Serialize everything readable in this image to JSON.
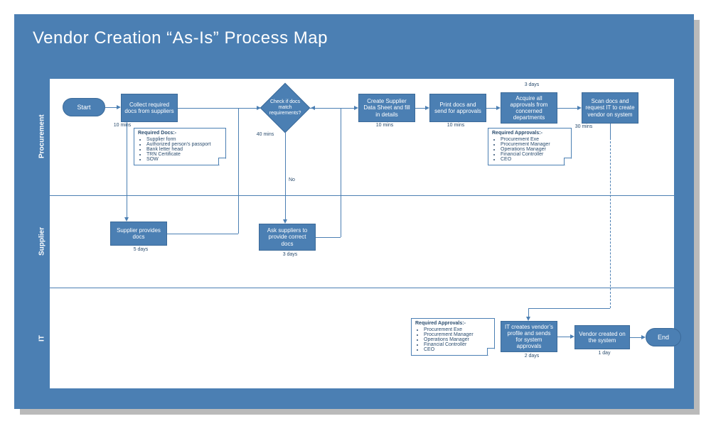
{
  "title": "Vendor Creation “As-Is” Process Map",
  "lanes": {
    "procurement": "Procurement",
    "supplier": "Supplier",
    "it": "IT"
  },
  "shapes": {
    "start": "Start",
    "collect": "Collect required docs from suppliers",
    "check": "Check if docs match requirements?",
    "create_sheet": "Create Supplier Data Sheet and fill in details",
    "print_send": "Print docs and send for approvals",
    "acquire": "Acquire all approvals from concerned departments",
    "scan_request": "Scan docs and request IT to create vendor on system",
    "supplier_provides": "Supplier provides docs",
    "ask_correct": "Ask suppliers to provide correct docs",
    "it_creates": "IT creates vendor’s profile and sends for system approvals",
    "vendor_created": "Vendor created on the system",
    "end": "End"
  },
  "timings": {
    "collect": "10 mins",
    "check": "40 mins",
    "create_sheet": "10 mins",
    "print_send": "10 mins",
    "acquire_top": "3 days",
    "scan_request": "30 mins",
    "supplier_provides": "5 days",
    "ask_correct": "3 days",
    "it_creates": "2 days",
    "vendor_created": "1 day"
  },
  "labels": {
    "no": "No"
  },
  "notes": {
    "required_docs": {
      "title": "Required Docs:-",
      "items": [
        "Supplier form",
        "Authorized person's passport",
        "Bank letter head",
        "TRN Certificate",
        "SOW"
      ]
    },
    "required_approvals": {
      "title": "Required Approvals:-",
      "items": [
        "Procurement Exe",
        "Procurement Manager",
        "Operations Manager",
        "Financial Controller",
        "CEO"
      ]
    }
  }
}
